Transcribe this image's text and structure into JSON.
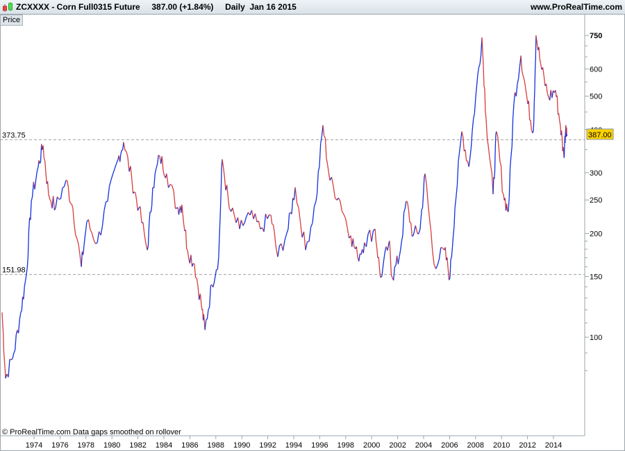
{
  "header": {
    "title": "ZCXXXX - Corn Full0315 Future     387.00 (+1.84%)     Daily  Jan 16 2015",
    "site": "www.ProRealTime.com",
    "tab": "Price"
  },
  "footer": "© ProRealTime.com  Data gaps smoothed on rollover",
  "colors": {
    "up": "#1030e0",
    "down": "#d83a3a",
    "badge": "#ffd200",
    "grid": "#9aa5ad"
  },
  "chart_data": {
    "type": "line",
    "title": "ZCXXXX - Corn Full0315 Future",
    "scale": "log",
    "ylim": [
      55,
      820
    ],
    "xlim": [
      1971.4,
      2015.7
    ],
    "yticks": [
      100,
      150,
      200,
      250,
      300,
      400,
      500,
      600,
      750
    ],
    "ytick_labels": [
      "100",
      "150",
      "200",
      "250",
      "300",
      "400",
      "500",
      "600",
      "750"
    ],
    "xticks": [
      1974,
      1976,
      1978,
      1980,
      1982,
      1984,
      1986,
      1988,
      1990,
      1992,
      1994,
      1996,
      1998,
      2000,
      2002,
      2004,
      2006,
      2008,
      2010,
      2012,
      2014
    ],
    "last_price": "387.00",
    "levels": [
      {
        "value": 373.75,
        "label": "373.75"
      },
      {
        "value": 151.98,
        "label": "151.98"
      }
    ],
    "series": [
      {
        "name": "Price",
        "points": [
          [
            1971.54,
            118
          ],
          [
            1971.81,
            76
          ],
          [
            1972.45,
            90
          ],
          [
            1972.98,
            118
          ],
          [
            1973.41,
            152
          ],
          [
            1973.79,
            248
          ],
          [
            1974.32,
            312
          ],
          [
            1974.7,
            360
          ],
          [
            1975.12,
            260
          ],
          [
            1975.66,
            237
          ],
          [
            1976.46,
            285
          ],
          [
            1976.99,
            237
          ],
          [
            1977.64,
            160
          ],
          [
            1978.06,
            216
          ],
          [
            1978.87,
            188
          ],
          [
            1979.67,
            248
          ],
          [
            1980.47,
            328
          ],
          [
            1980.9,
            368
          ],
          [
            1981.54,
            285
          ],
          [
            1982.07,
            237
          ],
          [
            1982.72,
            179
          ],
          [
            1983.14,
            272
          ],
          [
            1983.68,
            335
          ],
          [
            1984.21,
            298
          ],
          [
            1985.02,
            237
          ],
          [
            1985.39,
            242
          ],
          [
            1985.82,
            179
          ],
          [
            1986.35,
            163
          ],
          [
            1986.89,
            124
          ],
          [
            1987.16,
            105
          ],
          [
            1987.69,
            142
          ],
          [
            1988.22,
            171
          ],
          [
            1988.49,
            328
          ],
          [
            1989.03,
            237
          ],
          [
            1989.83,
            206
          ],
          [
            1990.63,
            226
          ],
          [
            1991.43,
            206
          ],
          [
            1992.24,
            226
          ],
          [
            1992.77,
            171
          ],
          [
            1993.57,
            206
          ],
          [
            1994.11,
            272
          ],
          [
            1994.91,
            179
          ],
          [
            1995.71,
            248
          ],
          [
            1996.25,
            412
          ],
          [
            1996.78,
            285
          ],
          [
            1997.58,
            248
          ],
          [
            1998.39,
            197
          ],
          [
            1998.92,
            171
          ],
          [
            1999.45,
            188
          ],
          [
            2000.26,
            206
          ],
          [
            2000.68,
            149
          ],
          [
            2001.33,
            188
          ],
          [
            2001.59,
            149
          ],
          [
            2002.13,
            171
          ],
          [
            2002.66,
            248
          ],
          [
            2003.2,
            197
          ],
          [
            2003.73,
            206
          ],
          [
            2004.11,
            298
          ],
          [
            2004.8,
            163
          ],
          [
            2005.6,
            179
          ],
          [
            2006.03,
            149
          ],
          [
            2006.41,
            237
          ],
          [
            2006.94,
            395
          ],
          [
            2007.48,
            312
          ],
          [
            2008.01,
            497
          ],
          [
            2008.49,
            740
          ],
          [
            2008.81,
            432
          ],
          [
            2009.35,
            260
          ],
          [
            2009.61,
            395
          ],
          [
            2010.15,
            260
          ],
          [
            2010.52,
            231
          ],
          [
            2010.95,
            475
          ],
          [
            2011.49,
            655
          ],
          [
            2012.02,
            475
          ],
          [
            2012.45,
            395
          ],
          [
            2012.66,
            750
          ],
          [
            2013.09,
            597
          ],
          [
            2013.62,
            497
          ],
          [
            2014.16,
            520
          ],
          [
            2014.53,
            412
          ],
          [
            2014.8,
            335
          ],
          [
            2014.95,
            412
          ],
          [
            2015.04,
            387
          ]
        ]
      }
    ]
  }
}
